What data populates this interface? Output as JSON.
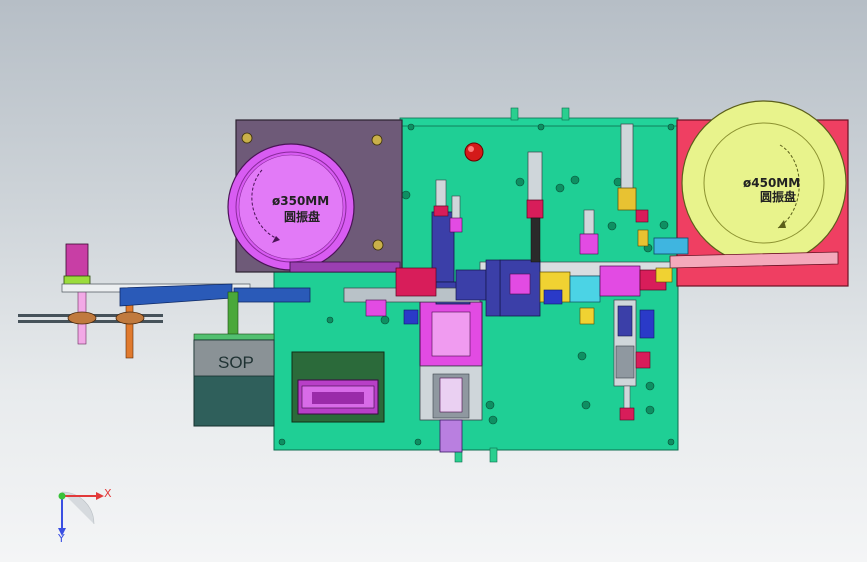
{
  "model": {
    "left_bowl": {
      "diameter_label": "ø350MM",
      "name_label": "圆振盘"
    },
    "right_bowl": {
      "diameter_label": "ø450MM",
      "name_label": "圆振盘"
    },
    "sop_box": {
      "label": "SOP"
    }
  },
  "triad": {
    "x_label": "X",
    "y_label": "Y"
  },
  "colors": {
    "background_top": "#b6bec6",
    "base_plate": "#1fcf95",
    "left_bowl_base": "#6e5a78",
    "left_bowl": "#d85cf2",
    "right_bowl_base": "#ef3f62",
    "right_bowl": "#e8f38c",
    "sop_box": "#2f5f5b",
    "belt_blue": "#2a5ab8",
    "x_axis": "#e23a3a",
    "y_axis": "#3a4fe2",
    "origin": "#39c239"
  }
}
